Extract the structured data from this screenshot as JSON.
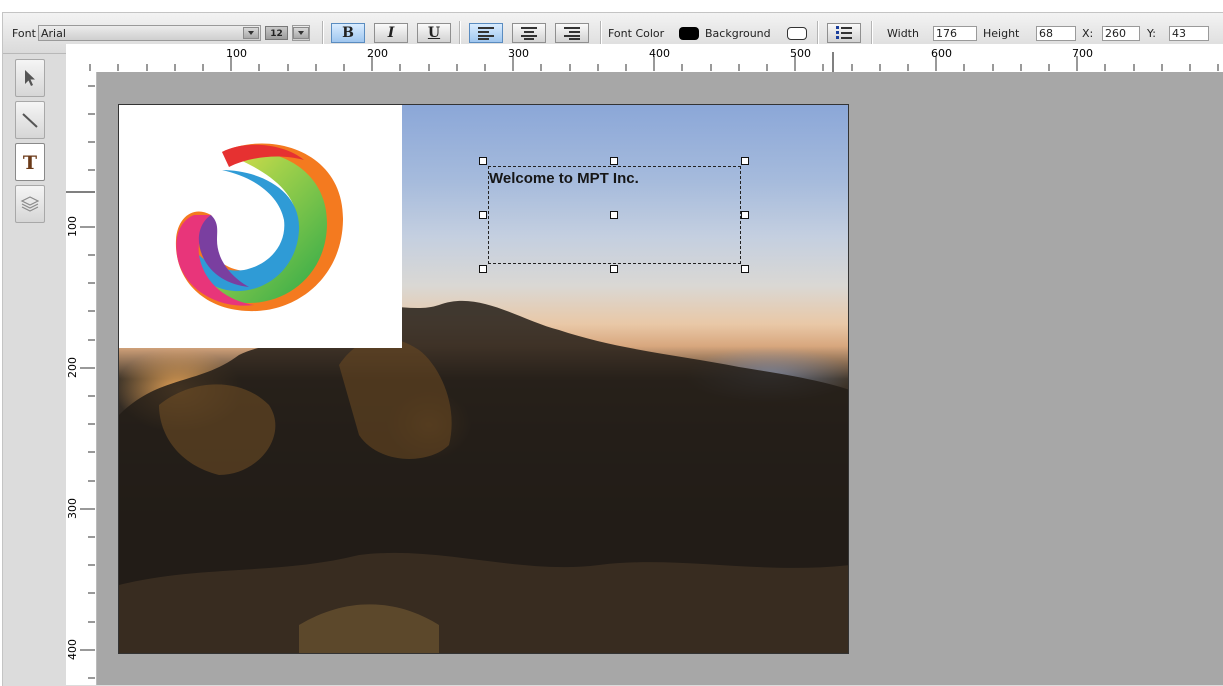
{
  "toolbar": {
    "font_label": "Font",
    "font_value": "Arial",
    "size_value": "12",
    "bold_label": "B",
    "italic_label": "I",
    "underline_label": "U",
    "font_color_label": "Font Color",
    "background_label": "Background",
    "width_label": "Width",
    "width_value": "176",
    "height_label": "Height",
    "height_value": "68",
    "x_label": "X:",
    "x_value": "260",
    "y_label": "Y:",
    "y_value": "43"
  },
  "tools": [
    "pointer-tool",
    "line-tool",
    "text-tool",
    "layers-tool"
  ],
  "ruler": {
    "top_labels": [
      "100",
      "200",
      "300",
      "400",
      "500",
      "600",
      "700"
    ],
    "left_labels": [
      "100",
      "200",
      "300",
      "400"
    ]
  },
  "canvas": {
    "text_content": "Welcome to MPT Inc."
  }
}
